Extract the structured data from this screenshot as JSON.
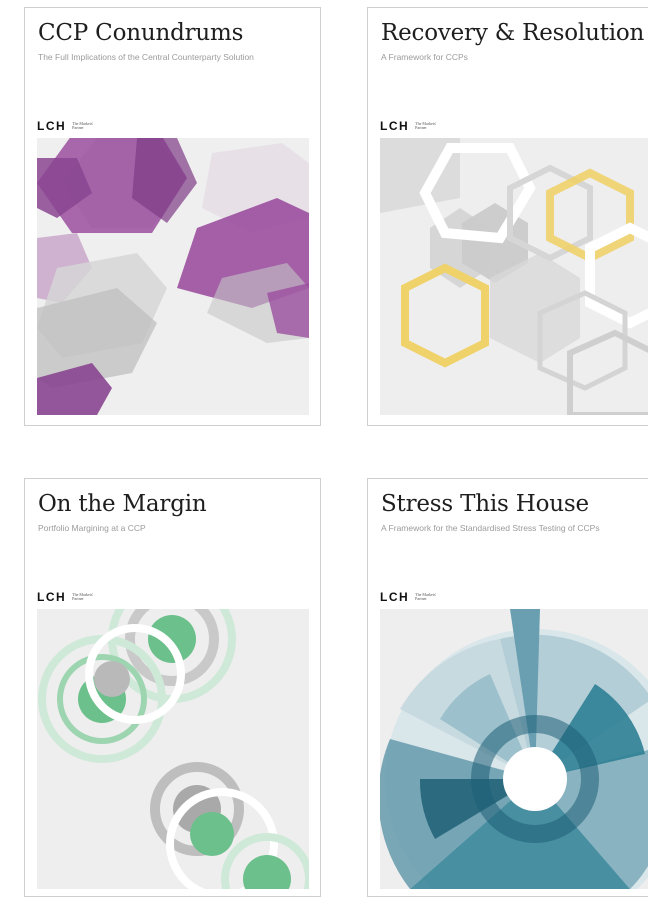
{
  "publications": [
    {
      "title": "CCP Conundrums",
      "subtitle": "The Full Implications of the Central Counterparty Solution",
      "brand": "LCH",
      "tagline": "The Markets' Partner",
      "art": "purple-hexagons",
      "accent": "#9b4f9f"
    },
    {
      "title": "Recovery & Resolution",
      "subtitle": "A Framework for CCPs",
      "brand": "LCH",
      "tagline": "The Markets' Partner",
      "art": "yellow-hexagon-outlines",
      "accent": "#f0d26a"
    },
    {
      "title": "On the Margin",
      "subtitle": "Portfolio Margining at a CCP",
      "brand": "LCH",
      "tagline": "The Markets' Partner",
      "art": "green-concentric-circles",
      "accent": "#6cc08b"
    },
    {
      "title": "Stress This House",
      "subtitle": "A Framework for the Standardised Stress Testing of CCPs",
      "brand": "LCH",
      "tagline": "The Markets' Partner",
      "art": "teal-radial-segments",
      "accent": "#2e7f95"
    }
  ]
}
